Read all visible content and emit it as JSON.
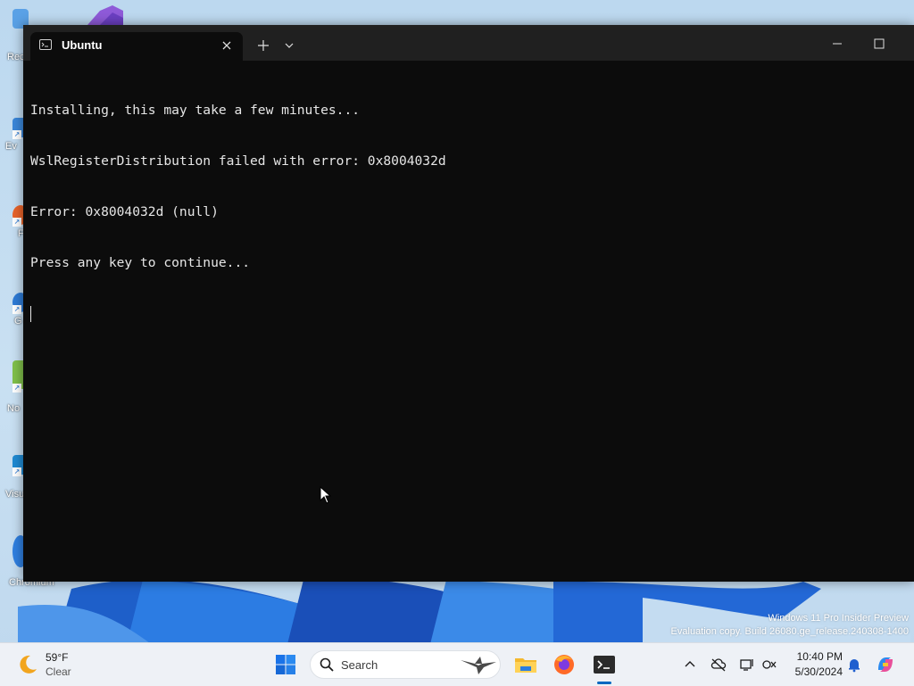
{
  "desktop": {
    "icons": [
      {
        "label": "Rec"
      },
      {
        "label": "Ev"
      },
      {
        "label": "F"
      },
      {
        "label": "G"
      },
      {
        "label": "No"
      },
      {
        "label": "Visu"
      },
      {
        "label": "Chromium"
      }
    ],
    "watermark": {
      "line1": "Windows 11 Pro Insider Preview",
      "line2": "Evaluation copy. Build 26080.ge_release.240308-1400"
    }
  },
  "terminal": {
    "tab_title": "Ubuntu",
    "lines": [
      "Installing, this may take a few minutes...",
      "WslRegisterDistribution failed with error: 0x8004032d",
      "Error: 0x8004032d (null)",
      "Press any key to continue..."
    ]
  },
  "taskbar": {
    "weather": {
      "temp": "59°F",
      "condition": "Clear"
    },
    "search": {
      "placeholder": "Search"
    },
    "apps": [
      {
        "icon": "file-explorer-icon"
      },
      {
        "icon": "firefox-icon"
      },
      {
        "icon": "terminal-icon"
      }
    ],
    "clock": {
      "time": "10:40 PM",
      "date": "5/30/2024"
    }
  },
  "colors": {
    "terminal_bg": "#0c0c0c",
    "titlebar_bg": "#202020",
    "console_text": "#e6e6e6",
    "taskbar_bg": "#eef1f6",
    "accent": "#0067c0"
  }
}
